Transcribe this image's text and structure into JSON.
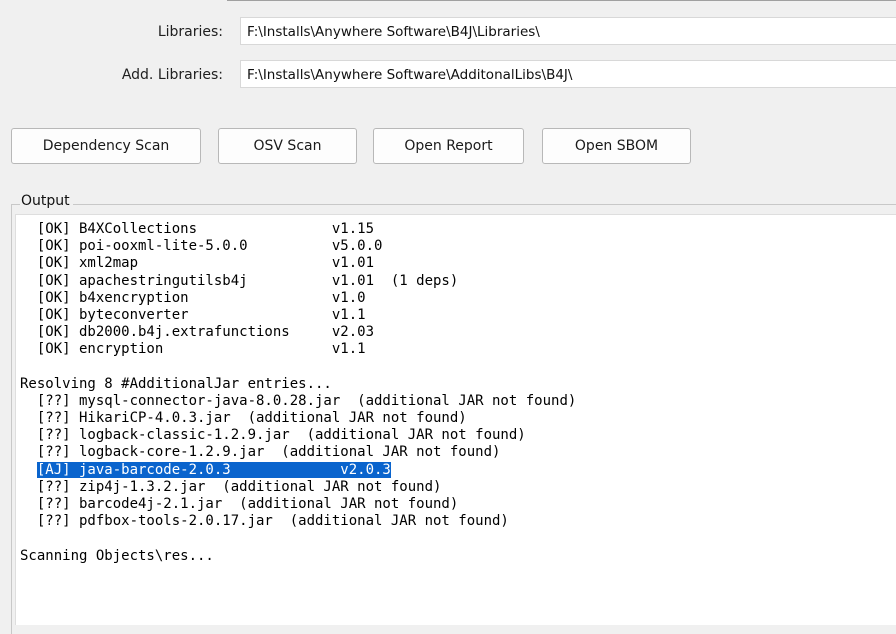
{
  "fields": {
    "libraries": {
      "label": "Libraries:",
      "value": "F:\\Installs\\Anywhere Software\\B4J\\Libraries\\"
    },
    "add_libraries": {
      "label": "Add. Libraries:",
      "value": "F:\\Installs\\Anywhere Software\\AdditonalLibs\\B4J\\"
    }
  },
  "buttons": {
    "dependency_scan": "Dependency Scan",
    "osv_scan": "OSV Scan",
    "open_report": "Open Report",
    "open_sbom": "Open SBOM"
  },
  "output": {
    "title": "Output",
    "lines": [
      "  [OK] B4XCollections                v1.15",
      "  [OK] poi-ooxml-lite-5.0.0          v5.0.0",
      "  [OK] xml2map                       v1.01",
      "  [OK] apachestringutilsb4j          v1.01  (1 deps)",
      "  [OK] b4xencryption                 v1.0",
      "  [OK] byteconverter                 v1.1",
      "  [OK] db2000.b4j.extrafunctions     v2.03",
      "  [OK] encryption                    v1.1",
      "",
      "Resolving 8 #AdditionalJar entries...",
      "  [??] mysql-connector-java-8.0.28.jar  (additional JAR not found)",
      "  [??] HikariCP-4.0.3.jar  (additional JAR not found)",
      "  [??] logback-classic-1.2.9.jar  (additional JAR not found)",
      "  [??] logback-core-1.2.9.jar  (additional JAR not found)",
      "  [AJ] java-barcode-2.0.3             v2.0.3",
      "  [??] zip4j-1.3.2.jar  (additional JAR not found)",
      "  [??] barcode4j-2.1.jar  (additional JAR not found)",
      "  [??] pdfbox-tools-2.0.17.jar  (additional JAR not found)",
      "",
      "Scanning Objects\\res..."
    ],
    "selected_line_index": 14
  },
  "colors": {
    "selection": "#0a64cd",
    "window_bg": "#f0f0f0"
  }
}
